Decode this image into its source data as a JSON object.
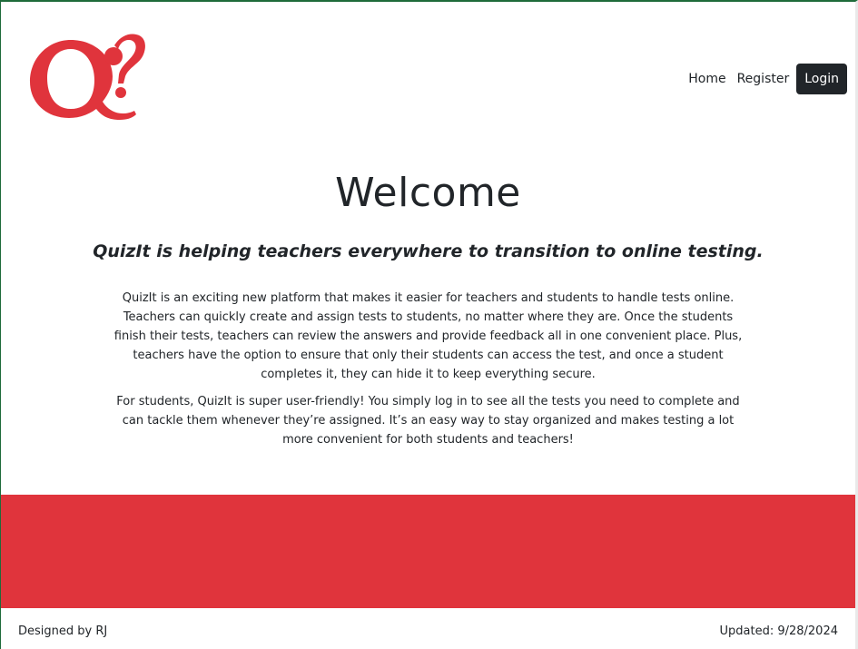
{
  "nav": {
    "home_label": "Home",
    "register_label": "Register",
    "login_label": "Login"
  },
  "main": {
    "title": "Welcome",
    "tagline": "QuizIt is helping teachers everywhere to transition to online testing.",
    "paragraph1": "QuizIt is an exciting new platform that makes it easier for teachers and students to handle tests online. Teachers can quickly create and assign tests to students, no matter where they are. Once the students finish their tests, teachers can review the answers and provide feedback all in one convenient place. Plus, teachers have the option to ensure that only their students can access the test, and once a student completes it, they can hide it to keep everything secure.",
    "paragraph2": "For students, QuizIt is super user-friendly! You simply log in to see all the tests you need to complete and can tackle them whenever they’re assigned. It’s an easy way to stay organized and makes testing a lot more convenient for both students and teachers!"
  },
  "footer": {
    "designed_by": "Designed by RJ",
    "updated": "Updated: 9/28/2024"
  },
  "colors": {
    "brand_red": "#e0343c",
    "dark": "#212529"
  },
  "icons": {
    "logo": "quizit-q-question-logo"
  }
}
